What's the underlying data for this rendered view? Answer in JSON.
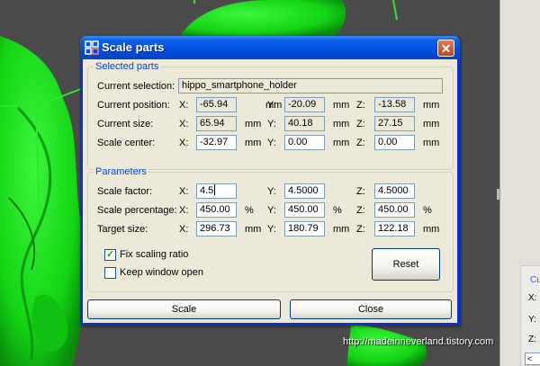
{
  "dialog": {
    "title": "Scale parts",
    "close_glyph": "✕"
  },
  "selected_parts": {
    "legend": "Selected parts",
    "current_selection_label": "Current selection:",
    "current_selection_value": "hippo_smartphone_holder",
    "current_position_label": "Current position:",
    "current_size_label": "Current size:",
    "scale_center_label": "Scale center:",
    "x_label": "X:",
    "y_label": "Y:",
    "z_label": "Z:",
    "unit_mm": "mm",
    "position": {
      "x": "-65.94",
      "y": "-20.09",
      "z": "-13.58"
    },
    "size": {
      "x": "65.94",
      "y": "40.18",
      "z": "27.15"
    },
    "center": {
      "x": "-32.97",
      "y": "0.00",
      "z": "0.00"
    }
  },
  "parameters": {
    "legend": "Parameters",
    "scale_factor_label": "Scale factor:",
    "scale_percentage_label": "Scale percentage:",
    "target_size_label": "Target size:",
    "unit_percent": "%",
    "unit_mm": "mm",
    "factor": {
      "x": "4.5",
      "y": "4.5000",
      "z": "4.5000"
    },
    "percentage": {
      "x": "450.00",
      "y": "450.00",
      "z": "450.00"
    },
    "target": {
      "x": "296.73",
      "y": "180.79",
      "z": "122.18"
    },
    "fix_scaling_ratio_label": "Fix scaling ratio",
    "fix_scaling_ratio_checked": true,
    "keep_window_open_label": "Keep window open",
    "keep_window_open_checked": false,
    "reset_label": "Reset"
  },
  "buttons": {
    "scale_label": "Scale",
    "close_label": "Close"
  },
  "side_panel": {
    "title": "Cu",
    "x": "X:",
    "y": "Y:",
    "z": "Z:",
    "field": "<"
  },
  "watermark": "http://madeinneverland.tistory.com",
  "colors": {
    "model_green": "#19e619",
    "titlebar_blue": "#0a5fe8",
    "group_title_blue": "#0046d5",
    "close_red": "#d9552f"
  }
}
